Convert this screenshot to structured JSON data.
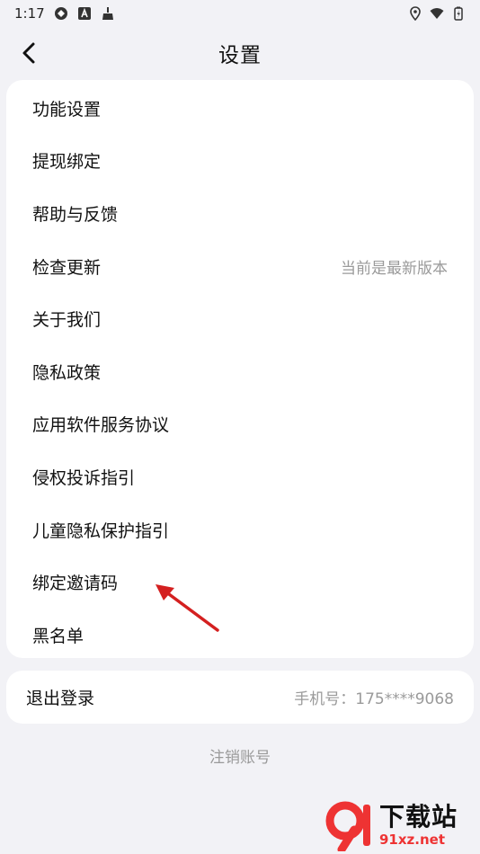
{
  "status_bar": {
    "time": "1:17",
    "icons_left": [
      "sync-icon",
      "a-badge-icon",
      "cleaner-icon"
    ],
    "icons_right": [
      "location-icon",
      "wifi-icon",
      "battery-icon"
    ]
  },
  "header": {
    "title": "设置"
  },
  "menu": {
    "items": [
      {
        "label": "功能设置",
        "value": ""
      },
      {
        "label": "提现绑定",
        "value": ""
      },
      {
        "label": "帮助与反馈",
        "value": ""
      },
      {
        "label": "检查更新",
        "value": "当前是最新版本"
      },
      {
        "label": "关于我们",
        "value": ""
      },
      {
        "label": "隐私政策",
        "value": ""
      },
      {
        "label": "应用软件服务协议",
        "value": ""
      },
      {
        "label": "侵权投诉指引",
        "value": ""
      },
      {
        "label": "儿童隐私保护指引",
        "value": ""
      },
      {
        "label": "绑定邀请码",
        "value": ""
      },
      {
        "label": "黑名单",
        "value": ""
      }
    ]
  },
  "account": {
    "logout_label": "退出登录",
    "phone_text": "手机号：175****9068"
  },
  "deregister_label": "注销账号",
  "watermark": {
    "big_text": "下载站",
    "small_text": "91xz.net"
  },
  "colors": {
    "background": "#f2f2f6",
    "card": "#ffffff",
    "secondary_text": "#9a9a9a",
    "annotation_arrow": "#d42020"
  }
}
